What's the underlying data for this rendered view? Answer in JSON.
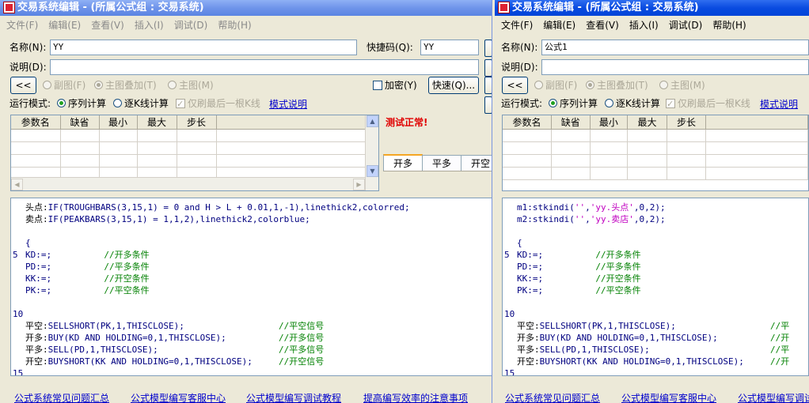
{
  "left": {
    "title": "交易系统编辑 - (所属公式组 : 交易系统)",
    "menu": [
      "文件(F)",
      "编辑(E)",
      "查看(V)",
      "插入(I)",
      "调试(D)",
      "帮助(H)"
    ],
    "name_label": "名称(N):",
    "name_value": "YY",
    "hotkey_label": "快捷码(Q):",
    "hotkey_value": "YY",
    "desc_label": "说明(D):",
    "collapse_label": "<<",
    "radio_sub": "副图(F)",
    "radio_main_overlay": "主图叠加(T)",
    "radio_main": "主图(M)",
    "encrypt_label": "加密(Y)",
    "quick_button": "快速(Q)...",
    "run_mode_label": "运行模式:",
    "mode_sequence": "序列计算",
    "mode_per_bar": "逐K线计算",
    "mode_last_bar": "仅刷最后一根K线",
    "mode_help_link": "模式说明",
    "param_headers": [
      "参数名",
      "缺省",
      "最小",
      "最大",
      "步长"
    ],
    "test_status": "测试正常!",
    "tabs": [
      "开多",
      "平多",
      "开空"
    ],
    "code": [
      {
        "n": "",
        "parts": [
          [
            "black",
            "头点:"
          ],
          [
            "blue",
            "IF(TROUGHBARS(3,15,1) = 0 and H > L + 0.01,1,-1),linethick2,colorred;"
          ]
        ]
      },
      {
        "n": "",
        "parts": [
          [
            "black",
            "卖点:"
          ],
          [
            "blue",
            "IF(PEAKBARS(3,15,1) = 1,1,2),linethick2,colorblue;"
          ]
        ]
      },
      {
        "n": "",
        "parts": []
      },
      {
        "n": "",
        "parts": [
          [
            "blue",
            "{"
          ]
        ]
      },
      {
        "n": "5",
        "parts": [
          [
            "blue",
            "KD:=;          "
          ],
          [
            "green",
            "//开多条件"
          ]
        ]
      },
      {
        "n": "",
        "parts": [
          [
            "blue",
            "PD:=;          "
          ],
          [
            "green",
            "//平多条件"
          ]
        ]
      },
      {
        "n": "",
        "parts": [
          [
            "blue",
            "KK:=;          "
          ],
          [
            "green",
            "//开空条件"
          ]
        ]
      },
      {
        "n": "",
        "parts": [
          [
            "blue",
            "PK:=;          "
          ],
          [
            "green",
            "//平空条件"
          ]
        ]
      },
      {
        "n": "",
        "parts": []
      },
      {
        "n": "10",
        "parts": []
      },
      {
        "n": "",
        "parts": [
          [
            "black",
            "平空:"
          ],
          [
            "blue",
            "SELLSHORT(PK,1,THISCLOSE);                  "
          ],
          [
            "green",
            "//平空信号"
          ]
        ]
      },
      {
        "n": "",
        "parts": [
          [
            "black",
            "开多:"
          ],
          [
            "blue",
            "BUY(KD AND HOLDING=0,1,THISCLOSE);          "
          ],
          [
            "green",
            "//开多信号"
          ]
        ]
      },
      {
        "n": "",
        "parts": [
          [
            "black",
            "平多:"
          ],
          [
            "blue",
            "SELL(PD,1,THISCLOSE);                       "
          ],
          [
            "green",
            "//平多信号"
          ]
        ]
      },
      {
        "n": "",
        "parts": [
          [
            "black",
            "开空:"
          ],
          [
            "blue",
            "BUYSHORT(KK AND HOLDING=0,1,THISCLOSE);     "
          ],
          [
            "green",
            "//开空信号"
          ]
        ]
      },
      {
        "n": "15",
        "parts": []
      }
    ],
    "links": [
      "公式系统常见问题汇总",
      "公式模型编写客服中心",
      "公式模型编写调试教程",
      "提高编写效率的注意事项"
    ]
  },
  "right": {
    "title": "交易系统编辑 - (所属公式组 : 交易系统)",
    "menu": [
      "文件(F)",
      "编辑(E)",
      "查看(V)",
      "插入(I)",
      "调试(D)",
      "帮助(H)"
    ],
    "name_label": "名称(N):",
    "name_value": "公式1",
    "desc_label": "说明(D):",
    "collapse_label": "<<",
    "radio_sub": "副图(F)",
    "radio_main_overlay": "主图叠加(T)",
    "radio_main": "主图(M)",
    "run_mode_label": "运行模式:",
    "mode_sequence": "序列计算",
    "mode_per_bar": "逐K线计算",
    "mode_last_bar": "仅刷最后一根K线",
    "mode_help_link": "模式说明",
    "param_headers": [
      "参数名",
      "缺省",
      "最小",
      "最大",
      "步长"
    ],
    "code": [
      {
        "n": "",
        "parts": [
          [
            "blue",
            "m1:stkindi("
          ],
          [
            "mag",
            "''"
          ],
          [
            "blue",
            ","
          ],
          [
            "mag",
            "'yy.头点'"
          ],
          [
            "blue",
            ",0,2);"
          ]
        ]
      },
      {
        "n": "",
        "parts": [
          [
            "blue",
            "m2:stkindi("
          ],
          [
            "mag",
            "''"
          ],
          [
            "blue",
            ","
          ],
          [
            "mag",
            "'yy.卖店'"
          ],
          [
            "blue",
            ",0,2);"
          ]
        ]
      },
      {
        "n": "",
        "parts": []
      },
      {
        "n": "",
        "parts": [
          [
            "blue",
            "{"
          ]
        ]
      },
      {
        "n": "5",
        "parts": [
          [
            "blue",
            "KD:=;          "
          ],
          [
            "green",
            "//开多条件"
          ]
        ]
      },
      {
        "n": "",
        "parts": [
          [
            "blue",
            "PD:=;          "
          ],
          [
            "green",
            "//平多条件"
          ]
        ]
      },
      {
        "n": "",
        "parts": [
          [
            "blue",
            "KK:=;          "
          ],
          [
            "green",
            "//开空条件"
          ]
        ]
      },
      {
        "n": "",
        "parts": [
          [
            "blue",
            "PK:=;          "
          ],
          [
            "green",
            "//平空条件"
          ]
        ]
      },
      {
        "n": "",
        "parts": []
      },
      {
        "n": "10",
        "parts": []
      },
      {
        "n": "",
        "parts": [
          [
            "black",
            "平空:"
          ],
          [
            "blue",
            "SELLSHORT(PK,1,THISCLOSE);                  "
          ],
          [
            "green",
            "//平"
          ]
        ]
      },
      {
        "n": "",
        "parts": [
          [
            "black",
            "开多:"
          ],
          [
            "blue",
            "BUY(KD AND HOLDING=0,1,THISCLOSE);          "
          ],
          [
            "green",
            "//开"
          ]
        ]
      },
      {
        "n": "",
        "parts": [
          [
            "black",
            "平多:"
          ],
          [
            "blue",
            "SELL(PD,1,THISCLOSE);                       "
          ],
          [
            "green",
            "//平"
          ]
        ]
      },
      {
        "n": "",
        "parts": [
          [
            "black",
            "开空:"
          ],
          [
            "blue",
            "BUYSHORT(KK AND HOLDING=0,1,THISCLOSE);     "
          ],
          [
            "green",
            "//开"
          ]
        ]
      },
      {
        "n": "15",
        "parts": []
      }
    ],
    "links": [
      "公式系统常见问题汇总",
      "公式模型编写客服中心",
      "公式模型编写调试"
    ]
  },
  "colors": {
    "keyword": "#000080",
    "comment": "#008000",
    "string": "#c000c0",
    "status_ok": "#e00000",
    "link": "#0000cc"
  }
}
